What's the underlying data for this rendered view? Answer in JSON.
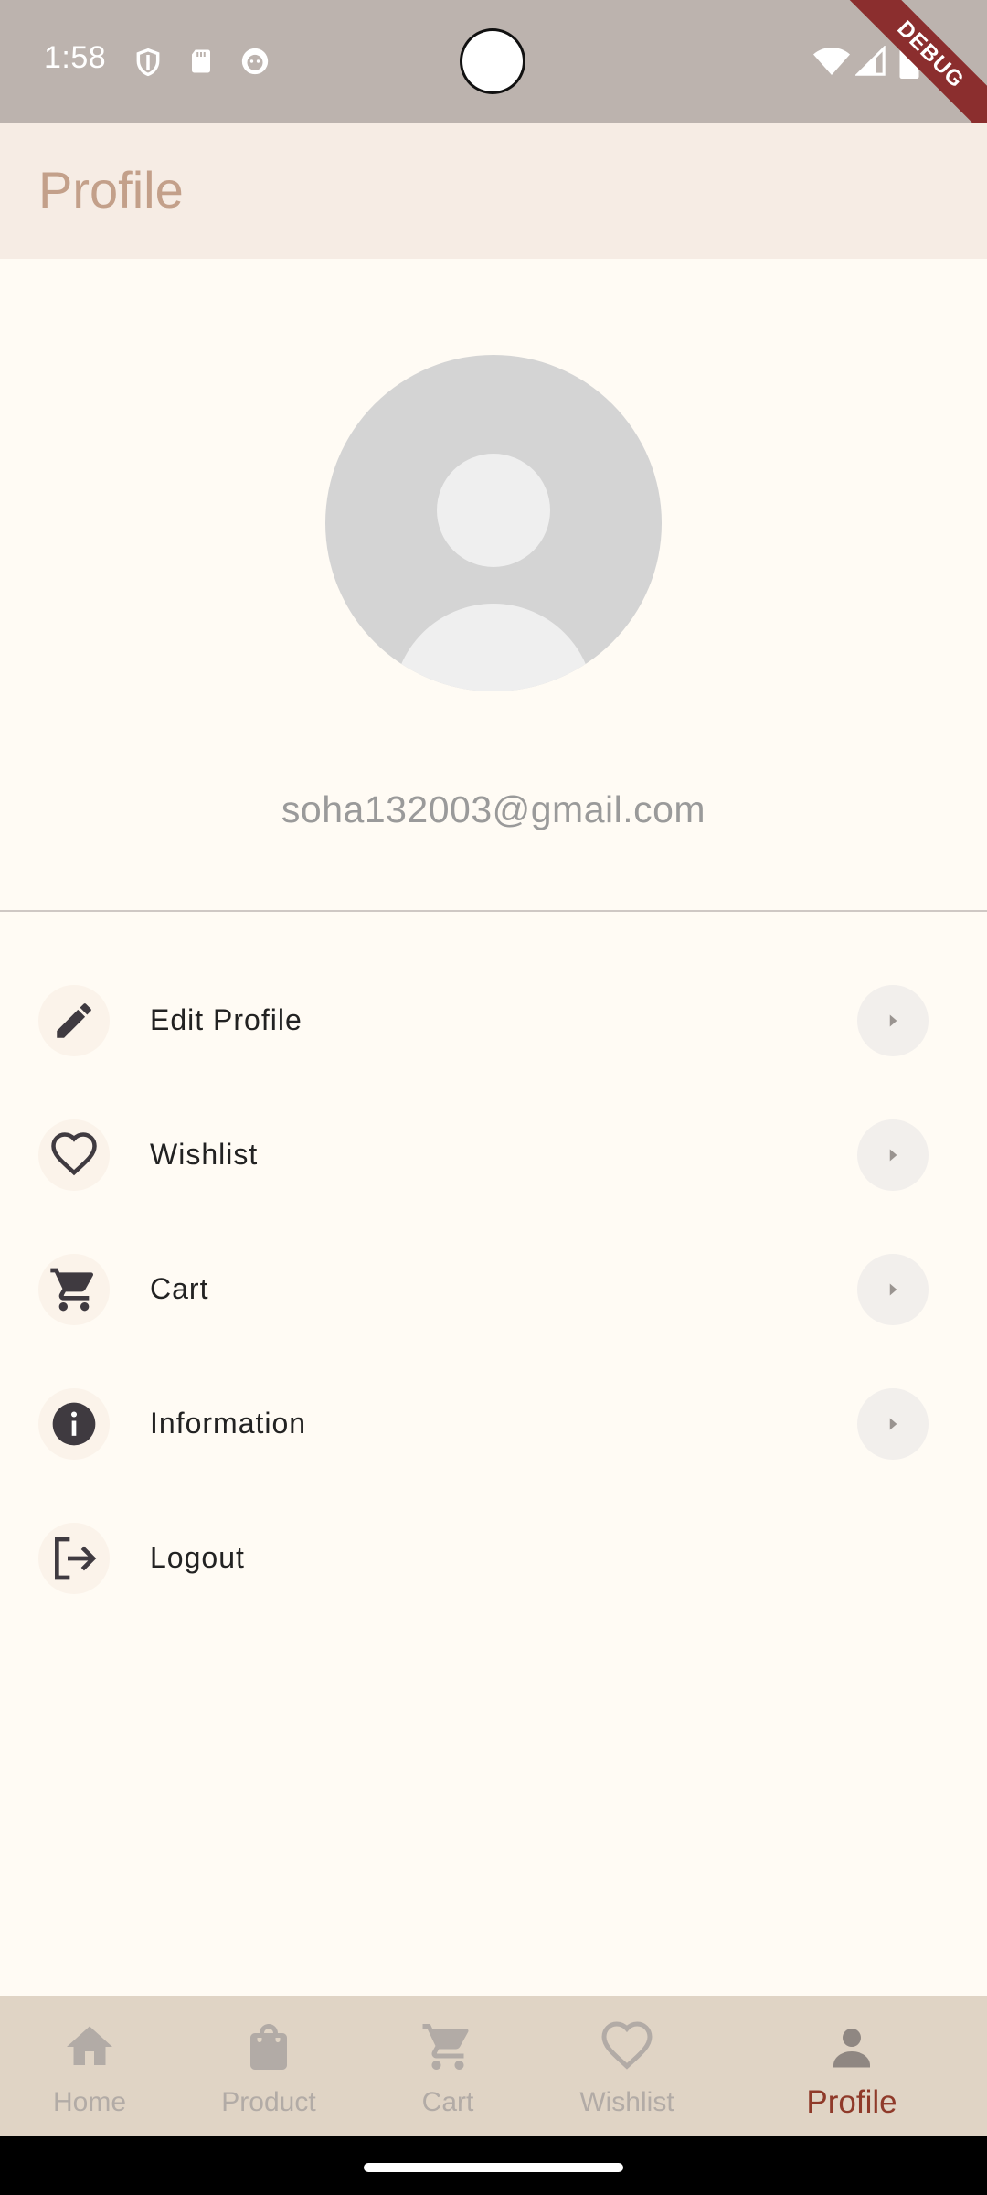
{
  "status_bar": {
    "time": "1:58",
    "icons_left": [
      "shield-icon",
      "sd-card-icon",
      "face-icon"
    ],
    "icons_right": [
      "wifi-icon",
      "signal-icon",
      "battery-icon"
    ],
    "debug_label": "DEBUG"
  },
  "app_bar": {
    "title": "Profile"
  },
  "profile": {
    "avatar_icon": "default-avatar-icon",
    "email": "soha132003@gmail.com"
  },
  "menu": [
    {
      "label": "Edit Profile",
      "icon": "pencil-icon",
      "has_arrow": true
    },
    {
      "label": "Wishlist",
      "icon": "heart-icon",
      "has_arrow": true
    },
    {
      "label": "Cart",
      "icon": "cart-icon",
      "has_arrow": true
    },
    {
      "label": "Information",
      "icon": "info-icon",
      "has_arrow": true
    },
    {
      "label": "Logout",
      "icon": "logout-icon",
      "has_arrow": false
    }
  ],
  "bottom_nav": {
    "items": [
      {
        "label": "Home",
        "icon": "home-icon"
      },
      {
        "label": "Product",
        "icon": "shopping-bag-icon"
      },
      {
        "label": "Cart",
        "icon": "cart-icon"
      },
      {
        "label": "Wishlist",
        "icon": "heart-outline-icon"
      },
      {
        "label": "Profile",
        "icon": "person-icon"
      }
    ],
    "active_index": 4
  },
  "colors": {
    "status_bar": "#bcb3ae",
    "app_bar": "#f6ece4",
    "background": "#fffbf4",
    "title": "#c3a08a",
    "nav_bar": "#e0d4c5",
    "nav_active": "#8f3a2a",
    "nav_inactive": "#b2aba6"
  }
}
